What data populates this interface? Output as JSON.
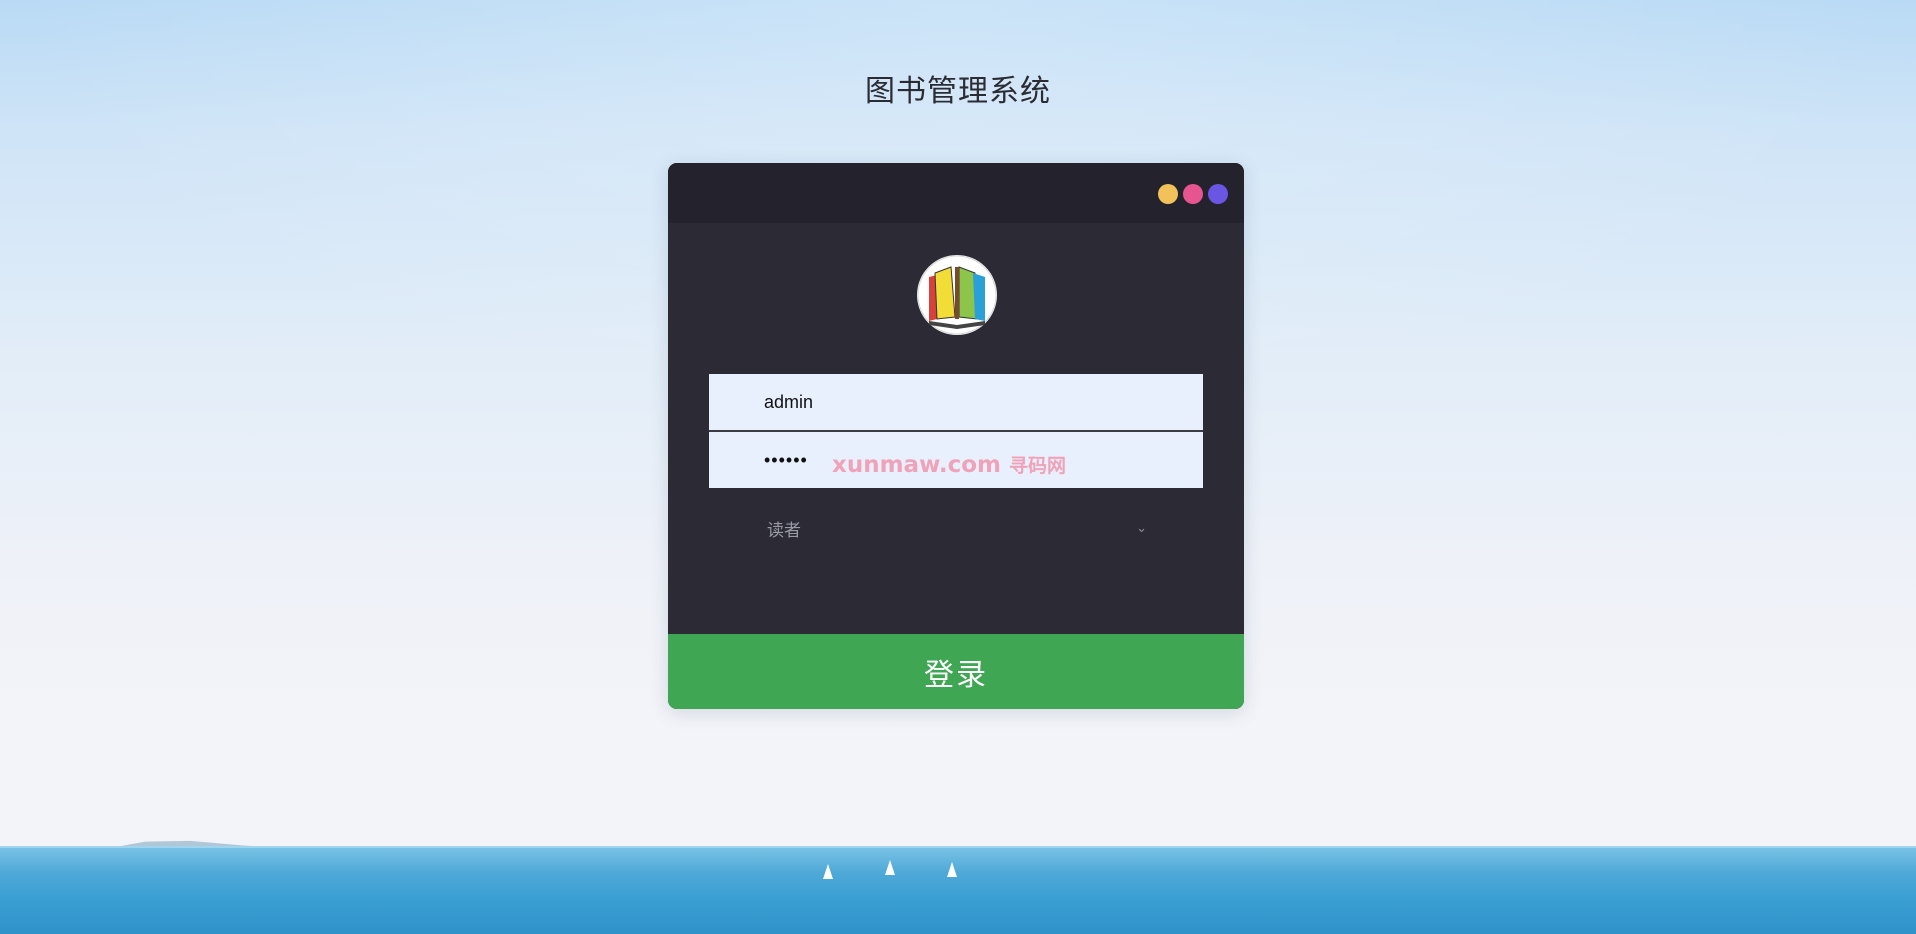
{
  "page": {
    "title": "图书管理系统"
  },
  "window": {
    "dots": [
      {
        "name": "yellow-dot",
        "color": "#f2c15a"
      },
      {
        "name": "pink-dot",
        "color": "#e6558f"
      },
      {
        "name": "purple-dot",
        "color": "#6b55e3"
      }
    ],
    "logo_icon": "open-book-icon"
  },
  "form": {
    "username_value": "admin",
    "password_value": "••••••",
    "role_selected": "读者",
    "role_chevron": "⌄",
    "login_label": "登录"
  },
  "watermark": {
    "text": "xunmaw.com",
    "text_cn": "寻码网"
  },
  "colors": {
    "card_bg": "#2b2a35",
    "titlebar_bg": "#24232d",
    "input_bg": "#e8f0fd",
    "login_button": "#3fa654"
  }
}
